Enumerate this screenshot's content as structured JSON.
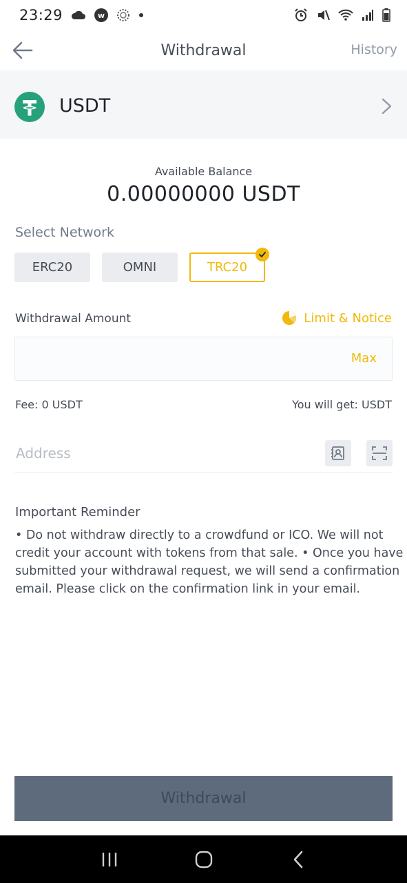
{
  "status_bar": {
    "time": "23:29",
    "icons_left": [
      "cloud-icon",
      "w-app-icon",
      "loading-icon",
      "dot-icon"
    ],
    "icons_right": [
      "alarm-icon",
      "mute-icon",
      "wifi-icon",
      "signal-icon",
      "battery-icon"
    ]
  },
  "header": {
    "title": "Withdrawal",
    "history_label": "History"
  },
  "coin": {
    "name": "USDT",
    "icon_color": "#26A17B"
  },
  "balance": {
    "label": "Available Balance",
    "value": "0.00000000 USDT"
  },
  "network": {
    "label": "Select Network",
    "options": [
      {
        "label": "ERC20",
        "selected": false
      },
      {
        "label": "OMNI",
        "selected": false
      },
      {
        "label": "TRC20",
        "selected": true
      }
    ]
  },
  "amount": {
    "label": "Withdrawal Amount",
    "limit_notice": "Limit & Notice",
    "value": "",
    "max_label": "Max"
  },
  "fee": {
    "fee_text": "Fee: 0 USDT",
    "get_text": "You will get: USDT"
  },
  "address": {
    "placeholder": "Address"
  },
  "reminder": {
    "title": "Important Reminder",
    "body": "• Do not withdraw directly to a crowdfund or ICO. We will not credit your account with tokens from that sale. • Once you have submitted your withdrawal request, we will send a confirmation email. Please click on the confirmation link in your email."
  },
  "submit": {
    "label": "Withdrawal"
  },
  "colors": {
    "accent": "#F0B90B",
    "submit_bg": "#5E6B7C",
    "coin_row_bg": "#F5F6F8"
  },
  "nav": {
    "items": [
      "recent-apps-icon",
      "home-icon",
      "back-nav-icon"
    ]
  }
}
